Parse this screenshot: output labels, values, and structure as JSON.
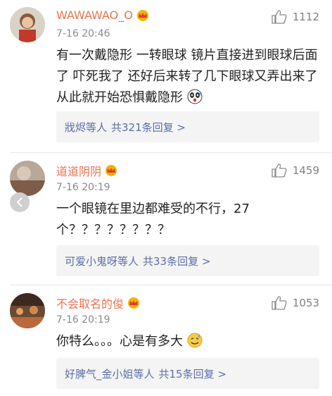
{
  "comments": [
    {
      "username": "WAWAWAO_O",
      "time": "7-16 20:46",
      "likes": "1112",
      "text": "有一次戴隐形 一转眼球 镜片直接进到眼球后面了 吓死我了 还好后来转了几下眼球又弄出来了 从此就开始恐惧戴隐形",
      "trailing_emoji": "panda-shock-emoji",
      "reply_users": "戕烬等人",
      "reply_count": "共321条回复 >"
    },
    {
      "username": "道道阴阴",
      "time": "7-16 20:19",
      "likes": "1459",
      "text": "一个眼镜在里边都难受的不行，27个？？？？？？？？",
      "reply_users": "可爱小鬼呀等人",
      "reply_count": "共33条回复 >"
    },
    {
      "username": "不会取名的俊",
      "time": "7-16 20:19",
      "likes": "1053",
      "text": "你特么。。。心是有多大",
      "trailing_emoji": "sweat-smile-emoji",
      "reply_users": "好脾气_金小姐等人",
      "reply_count": "共15条回复 >"
    }
  ],
  "colors": {
    "username": "#eb7350",
    "reply_link": "#5b6ea7",
    "meta": "#8a8a8a"
  },
  "icons": [
    "thumbs-up-icon",
    "vip-crown-icon",
    "chevron-left-icon"
  ]
}
